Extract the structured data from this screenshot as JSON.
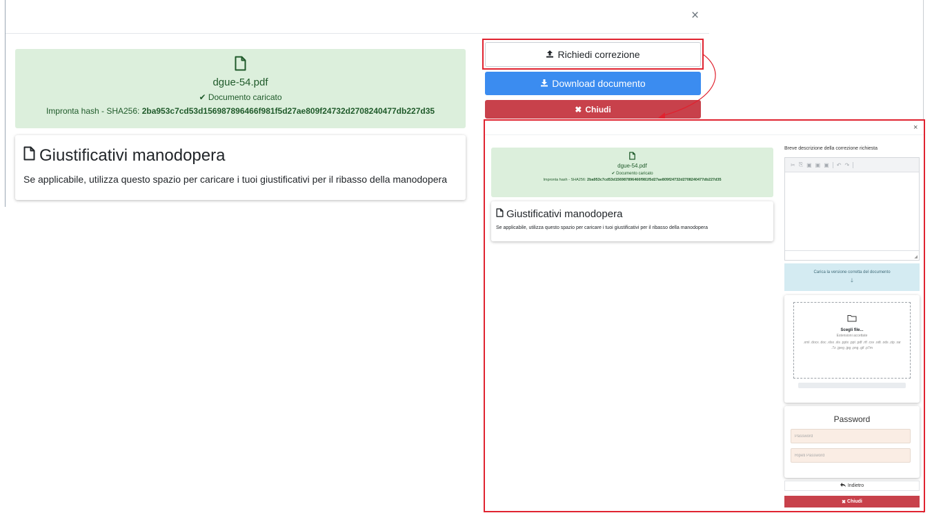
{
  "modal": {
    "close_symbol": "×"
  },
  "document": {
    "file_name": "dgue-54.pdf",
    "status": "Documento caricato",
    "hash_label": "Impronta hash - SHA256:",
    "hash_value": "2ba953c7cd53d156987896466f981f5d27ae809f24732d2708240477db227d35"
  },
  "section": {
    "title": "Giustificativi manodopera",
    "description": "Se applicabile, utilizza questo spazio per caricare i tuoi giustificativi per il ribasso della manodopera"
  },
  "actions": {
    "request_correction": "Richiedi correzione",
    "download": "Download documento",
    "close": "Chiudi"
  },
  "correction_panel": {
    "close_symbol": "×",
    "description_label": "Breve descrizione della correzione richiesta",
    "toolbar_icons": [
      "cut-icon",
      "copy-icon",
      "paste-icon",
      "paste-text-icon",
      "paste-word-icon",
      "undo-icon",
      "redo-icon"
    ],
    "upload_info": "Carica la versione corretta del documento",
    "choose_file": "Scegli file...",
    "extensions_label": "Estensioni accettate",
    "extensions": ".xml .docx .doc .xlsx .xls .pptx .ppt .pdf .rtf .csv .odt .ods .zip .rar .7z .jpeg .jpg .png .gif .p7m",
    "password_title": "Password",
    "password_placeholder": "Password",
    "repeat_password_placeholder": "Ripeti Password",
    "back": "Indietro",
    "close": "Chiudi"
  },
  "colors": {
    "success_bg": "#dcefdc",
    "primary": "#3b8cf0",
    "danger": "#c8414b",
    "highlight": "#e0222f",
    "info_bg": "#d4ebf2"
  }
}
